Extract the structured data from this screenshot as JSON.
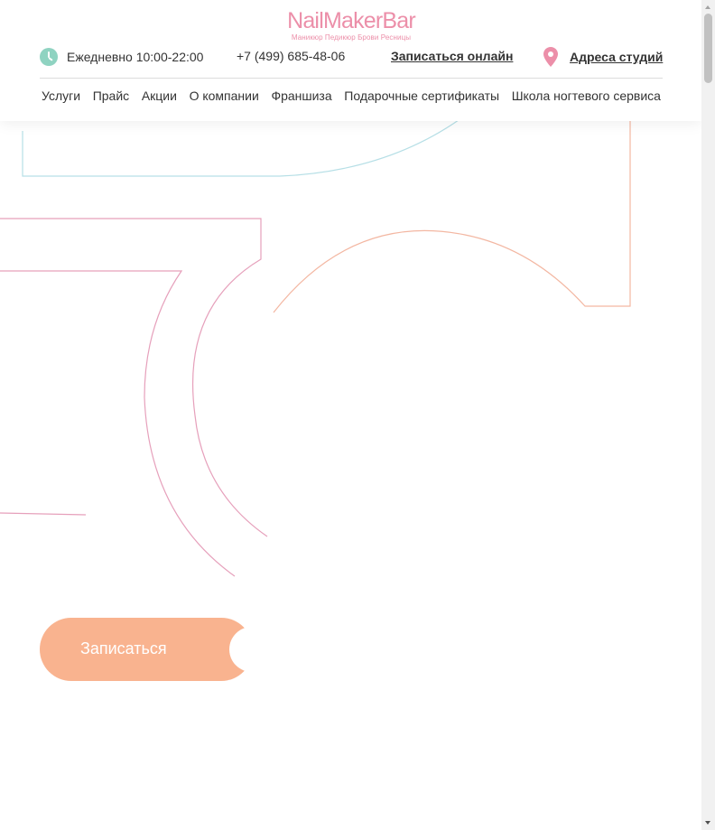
{
  "brand": {
    "name": "NailMakerBar",
    "tagline": "Маникюр  Педикюр  Брови  Ресницы",
    "color": "#ec8fa9"
  },
  "header": {
    "hours": "Ежедневно 10:00-22:00",
    "hours_icon": "clock-icon",
    "phone": "+7 (499) 685-48-06",
    "book_online": "Записаться онлайн",
    "addresses": "Адреса студий",
    "addresses_icon": "map-pin-icon"
  },
  "nav": {
    "items": [
      {
        "label": "Услуги"
      },
      {
        "label": "Прайс"
      },
      {
        "label": "Акции"
      },
      {
        "label": "О компании"
      },
      {
        "label": "Франшиза"
      },
      {
        "label": "Подарочные сертификаты"
      },
      {
        "label": "Школа ногтевого сервиса"
      }
    ]
  },
  "hero": {
    "cta_label": "Записаться",
    "cta_color": "#f9b38f"
  },
  "colors": {
    "outline_teal": "#b6dfe6",
    "outline_pink": "#e6a0bb",
    "outline_peach": "#f3b7a2",
    "clock_teal": "#8fd3c1"
  }
}
